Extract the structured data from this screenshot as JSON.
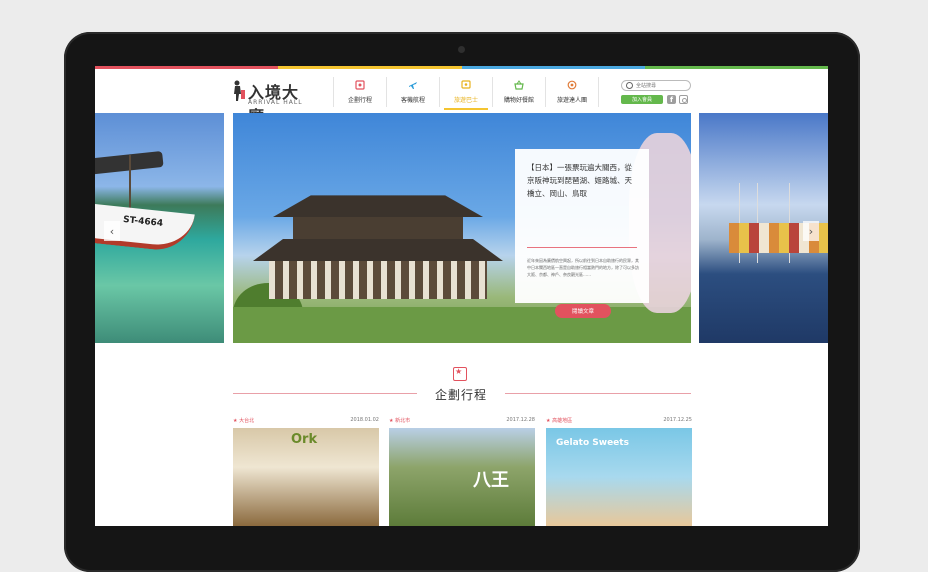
{
  "brand": {
    "name_zh": "入境大廳",
    "name_en": "ARRIVAL HALL"
  },
  "colors": {
    "accent_red": "#e2525e",
    "accent_yellow": "#f4c430",
    "accent_green": "#64b84c",
    "topbar": [
      "#e2525e",
      "#f4c430",
      "#4aa8e0",
      "#64b84c"
    ]
  },
  "nav": [
    {
      "label": "企劃行程",
      "icon": "itinerary-icon",
      "color": "#e2525e"
    },
    {
      "label": "客機航程",
      "icon": "plane-icon",
      "color": "#2a9bd8"
    },
    {
      "label": "旅遊巴士",
      "icon": "bus-icon",
      "color": "#e8b21e"
    },
    {
      "label": "購物好餐館",
      "icon": "basket-icon",
      "color": "#64b84c"
    },
    {
      "label": "旅遊達人團",
      "icon": "badge-icon",
      "color": "#e07b39"
    }
  ],
  "search": {
    "placeholder": "全站搜尋"
  },
  "member_button": "加入會員",
  "hero": {
    "title": "【日本】一張票玩遍大關西，從京阪神玩到琵琶湖、姬路城、天橋立、岡山、鳥取",
    "description": "近年來因為廉價航空興起，所以前往到日本自助旅行的民眾，其中日本關西地區一直是自助旅行相當熱門的地方，除了可以多訪大阪、京都、神戶、奈良觀光區……",
    "read_more": "閱讀文章",
    "boat_id": "ST-4664"
  },
  "section": {
    "title": "企劃行程"
  },
  "articles": [
    {
      "tag": "大台北",
      "date": "2018.01.02",
      "thumb_text": "Ork"
    },
    {
      "tag": "新北市",
      "date": "2017.12.28",
      "thumb_text": "八王"
    },
    {
      "tag": "高雄地區",
      "date": "2017.12.25",
      "thumb_text": "Gelato Sweets"
    }
  ]
}
